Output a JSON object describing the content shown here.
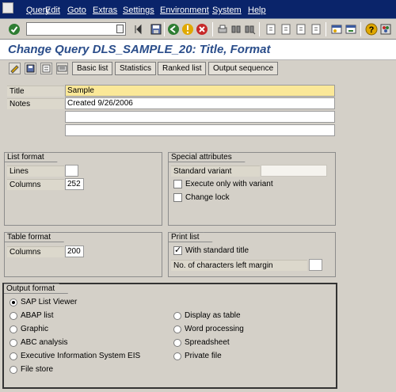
{
  "menubar": {
    "items": [
      "Query",
      "Edit",
      "Goto",
      "Extras",
      "Settings",
      "Environment",
      "System",
      "Help"
    ]
  },
  "toolbar": {
    "command_value": ""
  },
  "title": "Change Query DLS_SAMPLE_20: Title, Format",
  "app_toolbar": {
    "buttons": [
      "Basic list",
      "Statistics",
      "Ranked list",
      "Output sequence"
    ]
  },
  "header_fields": {
    "title_label": "Title",
    "title_value": "Sample",
    "notes_label": "Notes",
    "notes_lines": [
      "Created 9/26/2006",
      "",
      ""
    ]
  },
  "list_format": {
    "title": "List format",
    "lines_label": "Lines",
    "lines_value": "",
    "columns_label": "Columns",
    "columns_value": "252"
  },
  "special_attributes": {
    "title": "Special attributes",
    "standard_variant_label": "Standard variant",
    "standard_variant_value": "",
    "execute_only_label": "Execute only with variant",
    "execute_only_checked": false,
    "change_lock_label": "Change lock",
    "change_lock_checked": false
  },
  "table_format": {
    "title": "Table format",
    "columns_label": "Columns",
    "columns_value": "200"
  },
  "print_list": {
    "title": "Print list",
    "standard_title_label": "With standard title",
    "standard_title_checked": true,
    "left_margin_label": "No. of characters left margin",
    "left_margin_value": ""
  },
  "output_format": {
    "title": "Output format",
    "selected": "SAP List Viewer",
    "left_options": [
      "SAP List Viewer",
      "ABAP list",
      "Graphic",
      "ABC analysis",
      "Executive Information System EIS",
      "File store"
    ],
    "right_options": [
      "Display as table",
      "Word processing",
      "Spreadsheet",
      "Private file"
    ]
  },
  "colors": {
    "menubar_bg": "#0a246a",
    "title_text": "#2a4d8a",
    "required_field": "#fbe898",
    "panel_bg": "#d4d0c8"
  }
}
